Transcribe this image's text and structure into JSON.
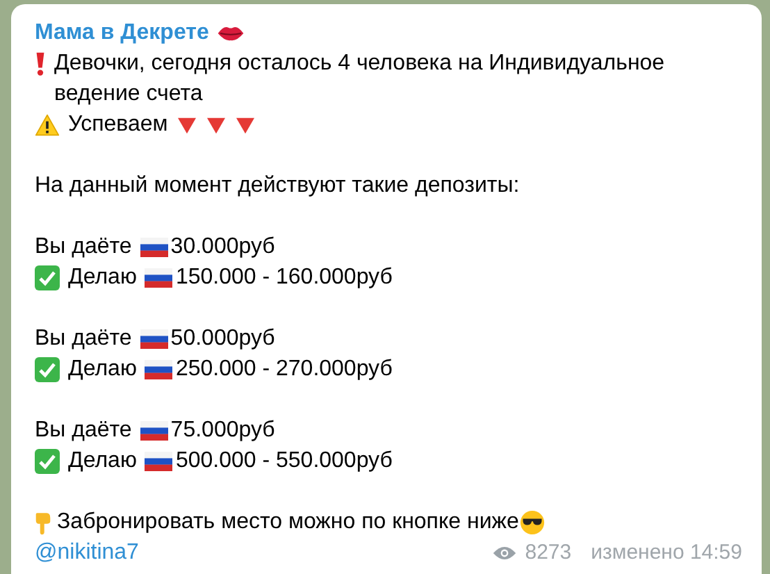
{
  "message": {
    "sender": "Мама в Декрете",
    "paragraphs": [
      [
        {
          "kind": "alert",
          "text": "Девочки, сегодня осталось 4 человека на Индивидуальное ведение счета"
        },
        {
          "kind": "hurry",
          "text": "Успеваем"
        }
      ],
      [
        {
          "kind": "plain",
          "text": "На данный момент действуют такие депозиты:"
        }
      ],
      [
        {
          "kind": "give",
          "label": "Вы даёте",
          "amount": "30.000руб"
        },
        {
          "kind": "get",
          "label": "Делаю",
          "amount": "150.000 - 160.000руб"
        }
      ],
      [
        {
          "kind": "give",
          "label": "Вы даёте",
          "amount": "50.000руб"
        },
        {
          "kind": "get",
          "label": "Делаю",
          "amount": "250.000 - 270.000руб"
        }
      ],
      [
        {
          "kind": "give",
          "label": "Вы даёте",
          "amount": "75.000руб"
        },
        {
          "kind": "get",
          "label": "Делаю",
          "amount": "500.000 - 550.000руб"
        }
      ],
      [
        {
          "kind": "cta",
          "text": "Забронировать место можно по кнопке ниже"
        }
      ]
    ],
    "author": "@nikitina7",
    "views": "8273",
    "status": "изменено 14:59"
  }
}
